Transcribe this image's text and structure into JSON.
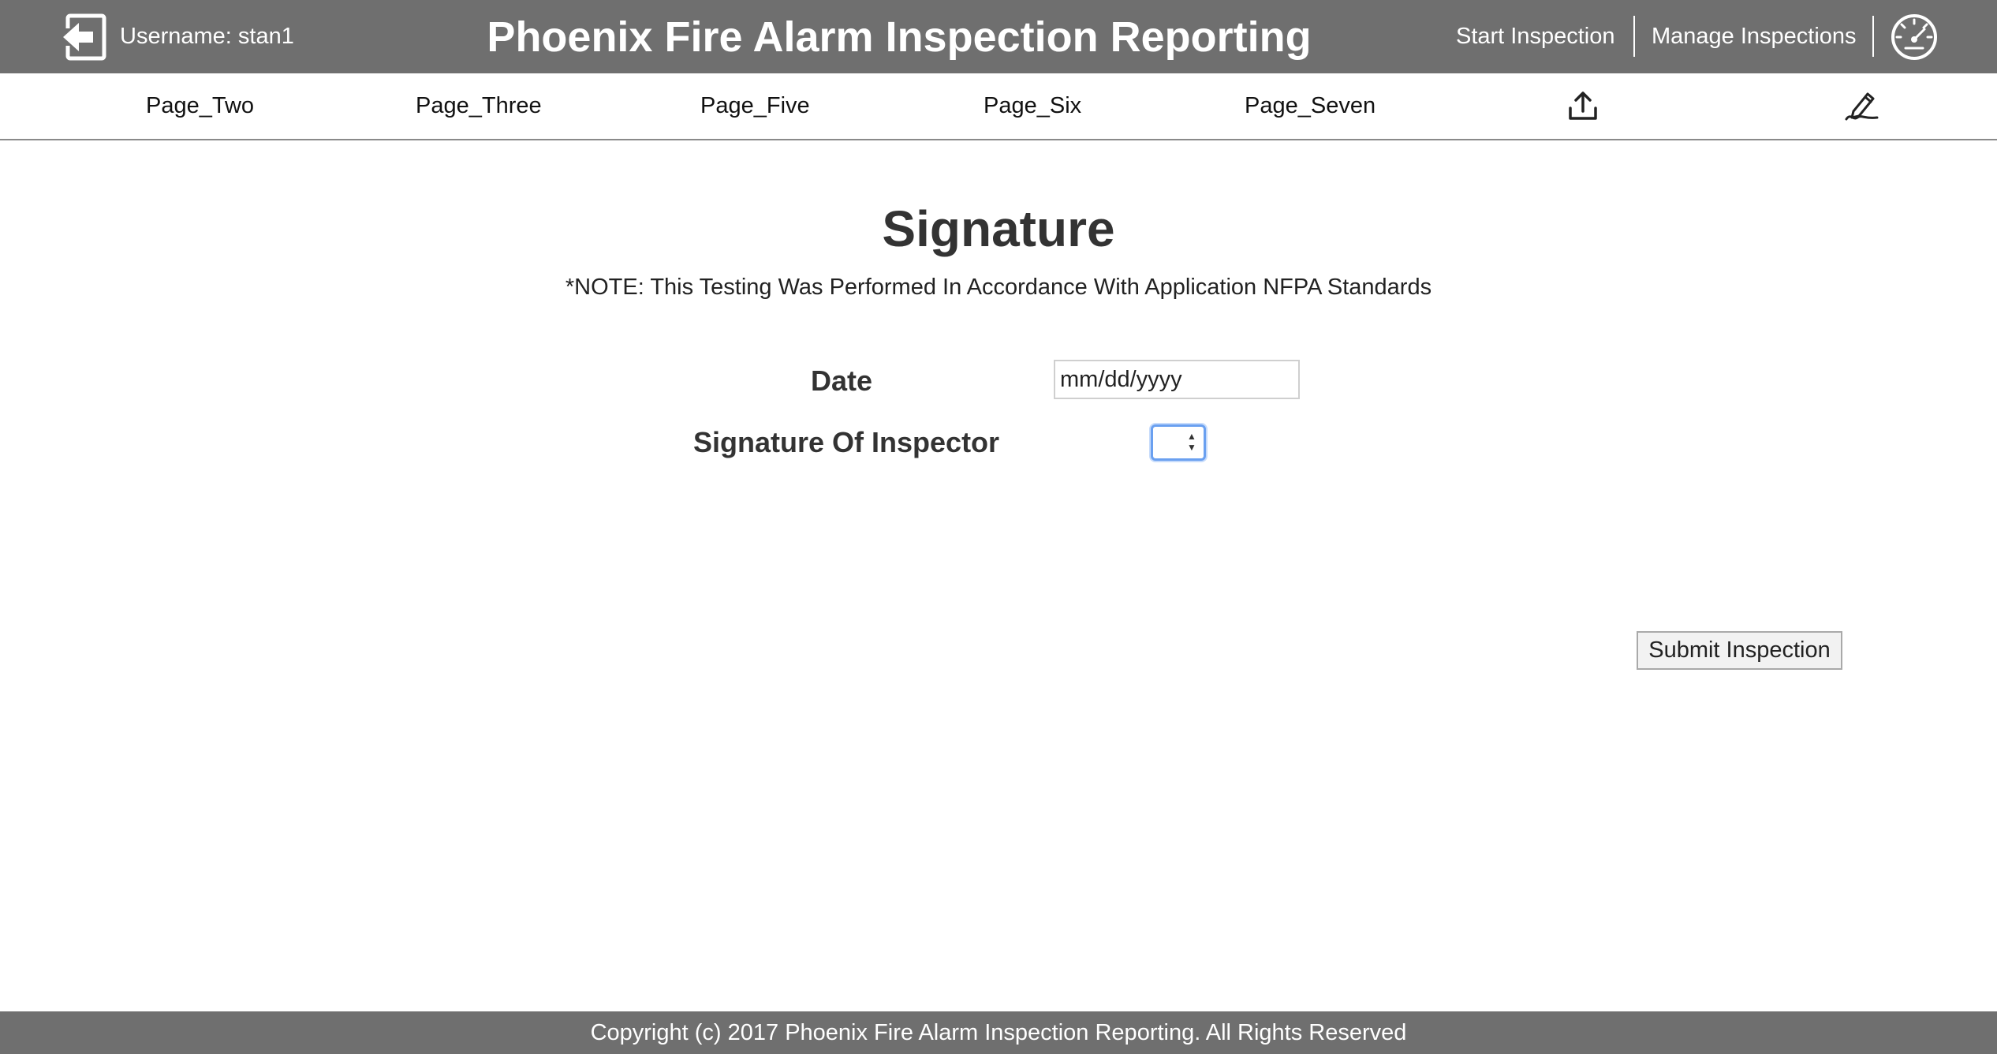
{
  "header": {
    "username": "Username: stan1",
    "title": "Phoenix Fire Alarm Inspection Reporting",
    "start_inspection": "Start Inspection",
    "manage_inspections": "Manage Inspections",
    "logout_icon": "logout-arrow-icon",
    "dashboard_icon": "speedometer-icon"
  },
  "nav": {
    "items": [
      "Page_Two",
      "Page_Three",
      "Page_Five",
      "Page_Six",
      "Page_Seven"
    ],
    "upload_icon": "upload-icon",
    "signature_icon": "signature-pen-icon"
  },
  "main": {
    "heading": "Signature",
    "note": "*NOTE: This Testing Was Performed In Accordance With Application NFPA Standards",
    "date_label": "Date",
    "date_placeholder": "mm/dd/yyyy",
    "signature_label": "Signature Of Inspector",
    "signature_value": "",
    "submit_label": "Submit Inspection"
  },
  "footer": {
    "copyright": "Copyright (c) 2017 Phoenix Fire Alarm Inspection Reporting. All Rights Reserved"
  },
  "colors": {
    "header_bg": "#6f6f6f",
    "focus_ring": "#6aa0f0"
  }
}
